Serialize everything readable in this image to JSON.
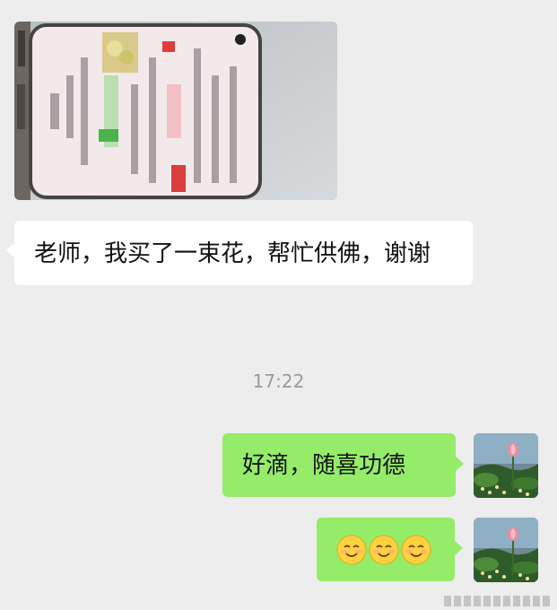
{
  "chat": {
    "photo_alt": "phone screenshot photo",
    "messages": [
      {
        "side": "left",
        "text": "老师，我买了一束花，帮忙供佛，谢谢"
      },
      {
        "side": "right",
        "text": "好滴，随喜功德"
      },
      {
        "side": "right",
        "emojis": [
          "smiling-face-emoji",
          "smiling-face-emoji",
          "smiling-face-emoji"
        ]
      }
    ],
    "timestamp": "17:22"
  },
  "colors": {
    "background": "#ededed",
    "incoming_bubble": "#ffffff",
    "outgoing_bubble": "#95ec69",
    "timestamp_text": "#9a9a9a"
  },
  "icons": {
    "avatar": "lotus-avatar-icon",
    "emoji": "smiling-face-emoji"
  }
}
